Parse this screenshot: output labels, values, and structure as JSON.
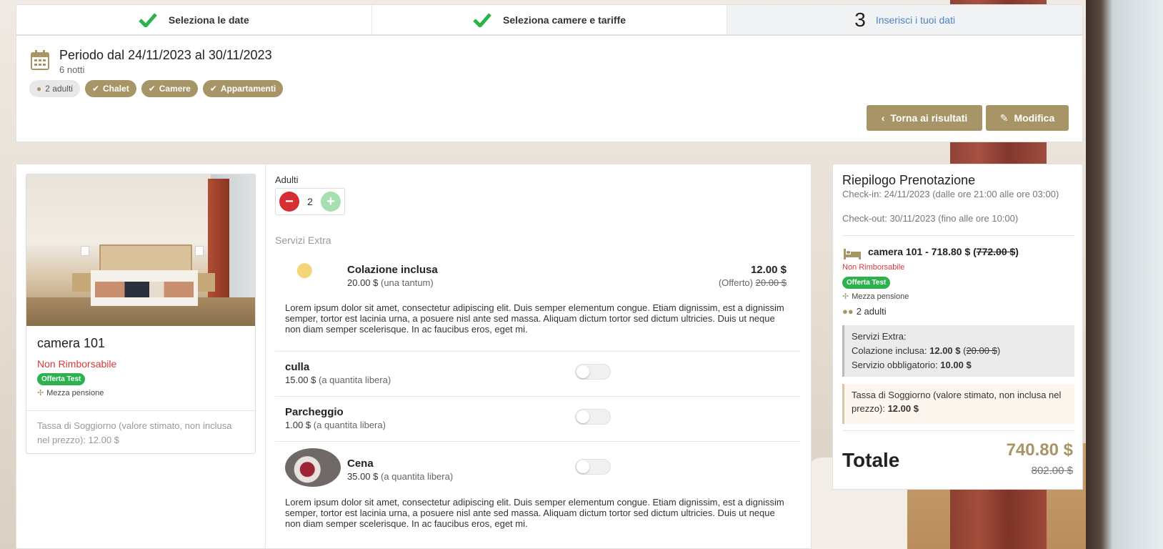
{
  "steps": [
    {
      "label": "Seleziona le date",
      "state": "done"
    },
    {
      "label": "Seleziona camere e tariffe",
      "state": "done"
    },
    {
      "number": "3",
      "label": "Inserisci i tuoi dati",
      "state": "active"
    }
  ],
  "summary": {
    "period": "Periodo dal 24/11/2023 al 30/11/2023",
    "nights": "6 notti",
    "tags": [
      "2 adulti",
      "Chalet",
      "Camere",
      "Appartamenti"
    ],
    "back_button": "Torna ai risultati",
    "edit_button": "Modifica"
  },
  "room": {
    "name": "camera 101",
    "refund": "Non Rimborsabile",
    "offer_badge": "Offerta Test",
    "meal_plan": "Mezza pensione",
    "tax_note": "Tassa di Soggiorno (valore stimato, non inclusa nel prezzo): 12.00 $"
  },
  "adults": {
    "label": "Adulti",
    "value": "2"
  },
  "extras": {
    "title": "Servizi Extra",
    "items": [
      {
        "name": "Colazione inclusa",
        "price": "20.00 $",
        "price_note": "(una tantum)",
        "right_price": "12.00 $",
        "offer_label": "(Offerto)",
        "offer_old": "20.00 $",
        "description": "Lorem ipsum dolor sit amet, consectetur adipiscing elit. Duis semper elementum congue. Etiam dignissim, est a dignissim semper, tortor est lacinia urna, a posuere nisl ante sed massa. Aliquam dictum tortor sed dictum ultricies. Duis ut neque non diam semper scelerisque. In ac faucibus eros, eget mi."
      },
      {
        "name": "culla",
        "price": "15.00 $",
        "price_note": "(a quantita libera)"
      },
      {
        "name": "Parcheggio",
        "price": "1.00 $",
        "price_note": "(a quantita libera)"
      },
      {
        "name": "Cena",
        "price": "35.00 $",
        "price_note": "(a quantita libera)",
        "description": "Lorem ipsum dolor sit amet, consectetur adipiscing elit. Duis semper elementum congue. Etiam dignissim, est a dignissim semper, tortor est lacinia urna, a posuere nisl ante sed massa. Aliquam dictum tortor sed dictum ultricies. Duis ut neque non diam semper scelerisque. In ac faucibus eros, eget mi."
      }
    ]
  },
  "recap": {
    "title": "Riepilogo Prenotazione",
    "checkin": "Check-in: 24/11/2023 (dalle ore 21:00 alle ore 03:00)",
    "checkout": "Check-out: 30/11/2023 (fino alle ore 10:00)",
    "room_line": "camera 101 - 718.80 $ (",
    "room_old": "772.00 $",
    "room_close": ")",
    "refund": "Non Rimborsabile",
    "offer_badge": "Offerta Test",
    "meal_plan": "Mezza pensione",
    "adults": "2 adulti",
    "extras_title": "Servizi Extra:",
    "extra1_label": "Colazione inclusa: ",
    "extra1_price": "12.00 $",
    "extra1_open": " (",
    "extra1_old": "20.00 $",
    "extra1_close": ")",
    "extra2_label": "Servizio obbligatorio: ",
    "extra2_price": "10.00 $",
    "tax_label": "Tassa di Soggiorno (valore stimato, non inclusa nel prezzo): ",
    "tax_value": "12.00 $",
    "total_label": "Totale",
    "total": "740.80 $",
    "total_old": "802.00 $"
  },
  "colors": {
    "accent": "#a89567",
    "success": "#2bb24c",
    "danger": "#d9383a",
    "link": "#4a86c5"
  }
}
